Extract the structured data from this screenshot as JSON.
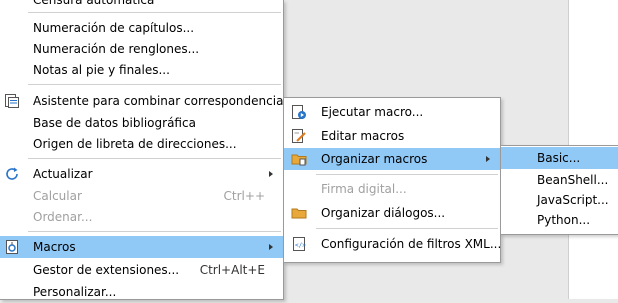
{
  "tools_menu": {
    "items": [
      {
        "label": "Censura automática"
      },
      {
        "label": "Numeración de capítulos..."
      },
      {
        "label": "Numeración de renglones..."
      },
      {
        "label": "Notas al pie y finales..."
      },
      {
        "label": "Asistente para combinar correspondencia..."
      },
      {
        "label": "Base de datos bibliográfica"
      },
      {
        "label": "Origen de libreta de direcciones..."
      },
      {
        "label": "Actualizar"
      },
      {
        "label": "Calcular",
        "shortcut": "Ctrl++"
      },
      {
        "label": "Ordenar..."
      },
      {
        "label": "Macros"
      },
      {
        "label": "Gestor de extensiones...",
        "shortcut": "Ctrl+Alt+E"
      },
      {
        "label": "Personalizar..."
      }
    ]
  },
  "macros_menu": {
    "items": [
      {
        "label": "Ejecutar macro..."
      },
      {
        "label": "Editar macros"
      },
      {
        "label": "Organizar macros"
      },
      {
        "label": "Firma digital..."
      },
      {
        "label": "Organizar diálogos..."
      },
      {
        "label": "Configuración de filtros XML..."
      }
    ]
  },
  "organize_macros_menu": {
    "items": [
      {
        "label": "Basic..."
      },
      {
        "label": "BeanShell..."
      },
      {
        "label": "JavaScript..."
      },
      {
        "label": "Python..."
      }
    ]
  },
  "icons": {
    "mail_merge": "mail-merge-icon",
    "update": "update-icon",
    "macros": "macros-icon",
    "run_macro": "run-macro-icon",
    "edit_macros": "edit-macros-icon",
    "organize_macros": "folder-icon",
    "organize_dialogs": "folder-icon",
    "xml_filter": "xml-filter-icon"
  },
  "colors": {
    "highlight": "#90c8f6",
    "disabled_text": "#a0a0a0",
    "folder": "#e8a93a"
  }
}
